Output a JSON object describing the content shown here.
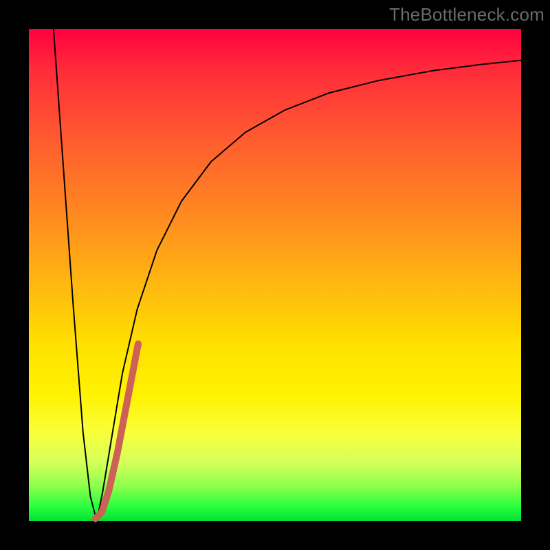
{
  "watermark": "TheBottleneck.com",
  "colors": {
    "frame": "#000000",
    "curve_primary": "#000000",
    "curve_secondary": "#cd6155",
    "gradient_top": "#ff0040",
    "gradient_bottom": "#00e034"
  },
  "chart_data": {
    "type": "line",
    "title": "",
    "xlabel": "",
    "ylabel": "",
    "xlim": [
      0,
      100
    ],
    "ylim": [
      0,
      100
    ],
    "grid": false,
    "legend": false,
    "series": [
      {
        "name": "bottleneck-curve",
        "color": "#000000",
        "stroke_width": 2,
        "x": [
          5,
          7,
          9,
          11,
          12.5,
          13.8,
          15,
          17,
          19,
          22,
          26,
          31,
          37,
          44,
          52,
          61,
          71,
          82,
          92,
          100
        ],
        "values": [
          100,
          72,
          44,
          18,
          5,
          0,
          6,
          18,
          30,
          43,
          55,
          65,
          73,
          79,
          83.5,
          87,
          89.5,
          91.5,
          92.8,
          93.6
        ]
      },
      {
        "name": "highlight-segment",
        "color": "#cd6155",
        "stroke_width": 10,
        "linecap": "round",
        "x": [
          13.5,
          14.8,
          16.2,
          18.0,
          20.0,
          22.2
        ],
        "values": [
          0.5,
          1.8,
          6.0,
          14.0,
          24.5,
          36.0
        ]
      }
    ]
  }
}
